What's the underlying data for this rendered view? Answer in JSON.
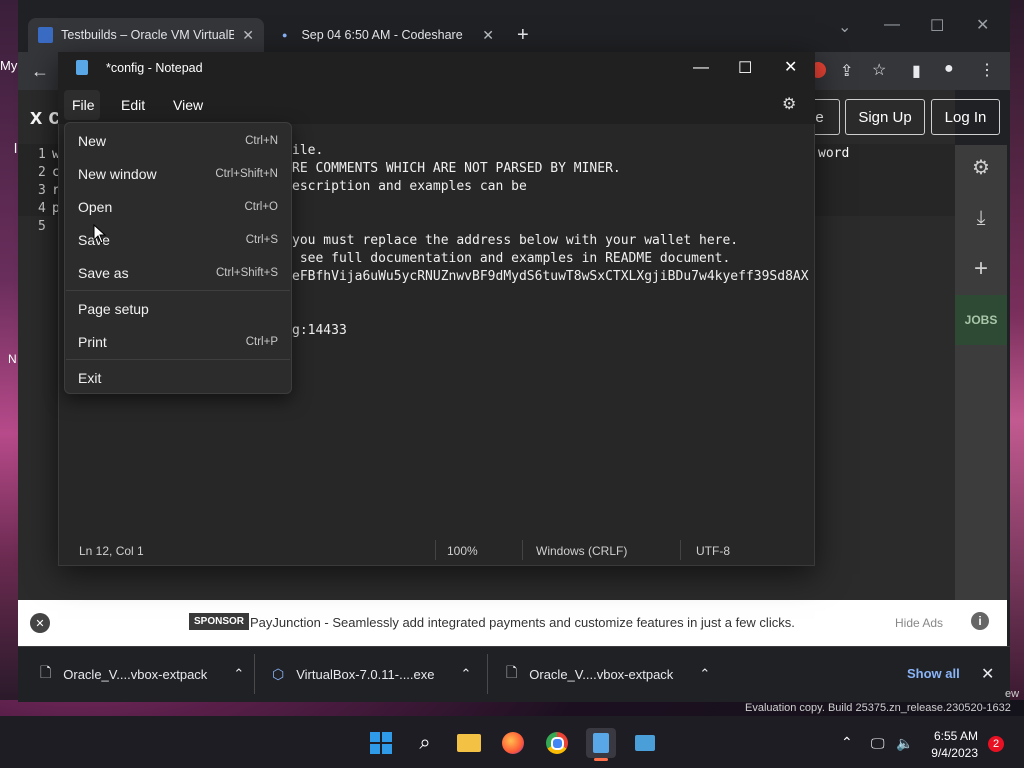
{
  "browser": {
    "tabs": [
      {
        "label": "Testbuilds – Oracle VM VirtualBo"
      },
      {
        "label": "Sep 04 6:50 AM - Codeshare"
      }
    ],
    "new_tab": "+",
    "page_buttons": {
      "partial": "e",
      "signup": "Sign Up",
      "login": "Log In"
    },
    "left_fragments": {
      "my": "My",
      "logo": "x c",
      "n": "N",
      "l": "l"
    },
    "code_lines": [
      "1",
      "2",
      "3",
      "4",
      "5"
    ],
    "code_chars": [
      "w",
      "c",
      "r",
      "p",
      ""
    ],
    "right_fragment": "word",
    "sidebar": {
      "jobs": "JOBS"
    },
    "ad": {
      "badge": "SPONSOR",
      "text": "PayJunction - Seamlessly add integrated payments and customize features in just a few clicks.",
      "hide": "Hide Ads"
    },
    "downloads": [
      {
        "name": "Oracle_V....vbox-extpack"
      },
      {
        "name": "VirtualBox-7.0.11-....exe"
      },
      {
        "name": "Oracle_V....vbox-extpack"
      }
    ],
    "show_all": "Show all",
    "eval_text": "Evaluation copy. Build 25375.zn_release.230520-1632",
    "ew": "ew"
  },
  "notepad": {
    "title": "*config - Notepad",
    "menu": {
      "file": "File",
      "edit": "Edit",
      "view": "View"
    },
    "lines": [
      "ile.",
      "RE COMMENTS WHICH ARE NOT PARSED BY MINER.",
      "escription and examples can be",
      "",
      "",
      "you must replace the address below with your wallet here.",
      " see full documentation and examples in README document.",
      "eFBfhVija6uWu5ycRNUZnwvBF9dMydS6tuwT8wSxCTXLXgjiBDu7w4kyeff39Sd8AX",
      "",
      "",
      "g:14433"
    ],
    "status": {
      "pos": "Ln 12, Col 1",
      "zoom": "100%",
      "eol": "Windows (CRLF)",
      "enc": "UTF-8"
    }
  },
  "file_menu": [
    {
      "label": "New",
      "shortcut": "Ctrl+N"
    },
    {
      "label": "New window",
      "shortcut": "Ctrl+Shift+N"
    },
    {
      "label": "Open",
      "shortcut": "Ctrl+O"
    },
    {
      "label": "Save",
      "shortcut": "Ctrl+S"
    },
    {
      "label": "Save as",
      "shortcut": "Ctrl+Shift+S"
    },
    {
      "label": "Page setup",
      "shortcut": ""
    },
    {
      "label": "Print",
      "shortcut": "Ctrl+P"
    },
    {
      "label": "Exit",
      "shortcut": ""
    }
  ],
  "taskbar": {
    "time": "6:55 AM",
    "date": "9/4/2023",
    "notifications": "2"
  },
  "colors": {
    "accent": "#0078d4",
    "sponsor_badge": "#3a3a3a",
    "notification_badge": "#e81123"
  }
}
